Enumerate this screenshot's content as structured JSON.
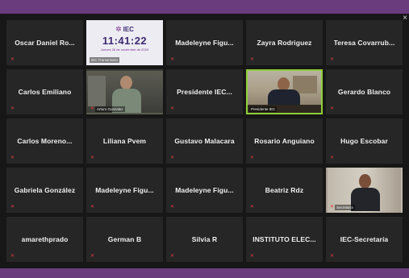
{
  "window": {
    "close_glyph": "×"
  },
  "participants": [
    {
      "name": "Oscar Daniel Ro...",
      "muted": true
    },
    {
      "name": "",
      "muted": true,
      "video": "iec-clock",
      "video_label": "IEC Transmisión"
    },
    {
      "name": "Madeleyne Figu...",
      "muted": true
    },
    {
      "name": "Zayra Rodriguez",
      "muted": true
    },
    {
      "name": "Teresa Covarrub...",
      "muted": true
    },
    {
      "name": "Carlos Emiliano",
      "muted": true
    },
    {
      "name": "",
      "muted": true,
      "video": "camera",
      "video_label": "Arturo Gonzalez"
    },
    {
      "name": "Presidente IEC...",
      "muted": true
    },
    {
      "name": "",
      "muted": false,
      "active_speaker": true,
      "video": "camera",
      "video_label": "Presidente IEC"
    },
    {
      "name": "Gerardo Blanco",
      "muted": true
    },
    {
      "name": "Carlos Moreno...",
      "muted": true
    },
    {
      "name": "Liliana Pvem",
      "muted": true
    },
    {
      "name": "Gustavo Malacara",
      "muted": true
    },
    {
      "name": "Rosario Anguiano",
      "muted": true
    },
    {
      "name": "Hugo Escobar",
      "muted": true
    },
    {
      "name": "Gabriela González",
      "muted": true
    },
    {
      "name": "Madeleyne Figu...",
      "muted": true
    },
    {
      "name": "Madeleyne Figu...",
      "muted": true
    },
    {
      "name": "Beatriz Rdz",
      "muted": true
    },
    {
      "name": "",
      "muted": true,
      "video": "camera",
      "video_label": "Secretaría"
    },
    {
      "name": "amarethprado",
      "muted": true
    },
    {
      "name": "German B",
      "muted": true
    },
    {
      "name": "Silvia R",
      "muted": true
    },
    {
      "name": "INSTITUTO ELEC...",
      "muted": true
    },
    {
      "name": "IEC-Secretaría",
      "muted": true
    }
  ],
  "iec_clock": {
    "logo_text": "IEC",
    "time": "11:41:22",
    "date": "Jueves 26 de noviembre de 2020"
  },
  "colors": {
    "frame": "#5b2d6b",
    "tile_bg": "#262626",
    "active_speaker_border": "#8fcf3a",
    "muted_icon": "#e23b3b"
  },
  "icons": {
    "muted": "mic-off-icon",
    "close": "close-icon",
    "logo": "iec-logo-icon"
  }
}
